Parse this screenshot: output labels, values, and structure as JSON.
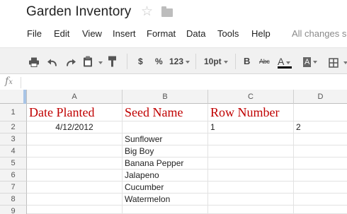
{
  "document": {
    "title": "Garden Inventory"
  },
  "icons": {
    "star": "star-icon",
    "folder": "folder-icon",
    "formula": "fx-icon"
  },
  "menu": {
    "items": [
      "File",
      "Edit",
      "View",
      "Insert",
      "Format",
      "Data",
      "Tools",
      "Help"
    ],
    "save_status": "All changes s"
  },
  "toolbar": {
    "print": "print-icon",
    "undo": "undo-icon",
    "redo": "redo-icon",
    "paste_format": "clipboard-icon",
    "paint_format": "paint-format-icon",
    "currency_label": "$",
    "percent_label": "%",
    "number_format_label": "123",
    "font_size_label": "10pt",
    "bold_label": "B",
    "strikethrough_label": "Abc",
    "text_color_label": "A",
    "fill_color_label": "A",
    "borders": "borders-icon",
    "text_color_value": "#000000"
  },
  "formula_bar": {
    "value": ""
  },
  "sheet": {
    "columns": [
      "A",
      "B",
      "C",
      "D"
    ],
    "rows": [
      "1",
      "2",
      "3",
      "4",
      "5",
      "6",
      "7",
      "8",
      "9"
    ],
    "cells": {
      "A1": "Date Planted",
      "B1": "Seed Name",
      "C1": "Row Number",
      "A2": "4/12/2012",
      "C2": "1",
      "D2": "2",
      "B3": "Sunflower",
      "B4": "Big Boy",
      "B5": "Banana Pepper",
      "B6": "Jalapeno",
      "B7": "Cucumber",
      "B8": "Watermelon"
    },
    "header_color": "#c00000"
  }
}
